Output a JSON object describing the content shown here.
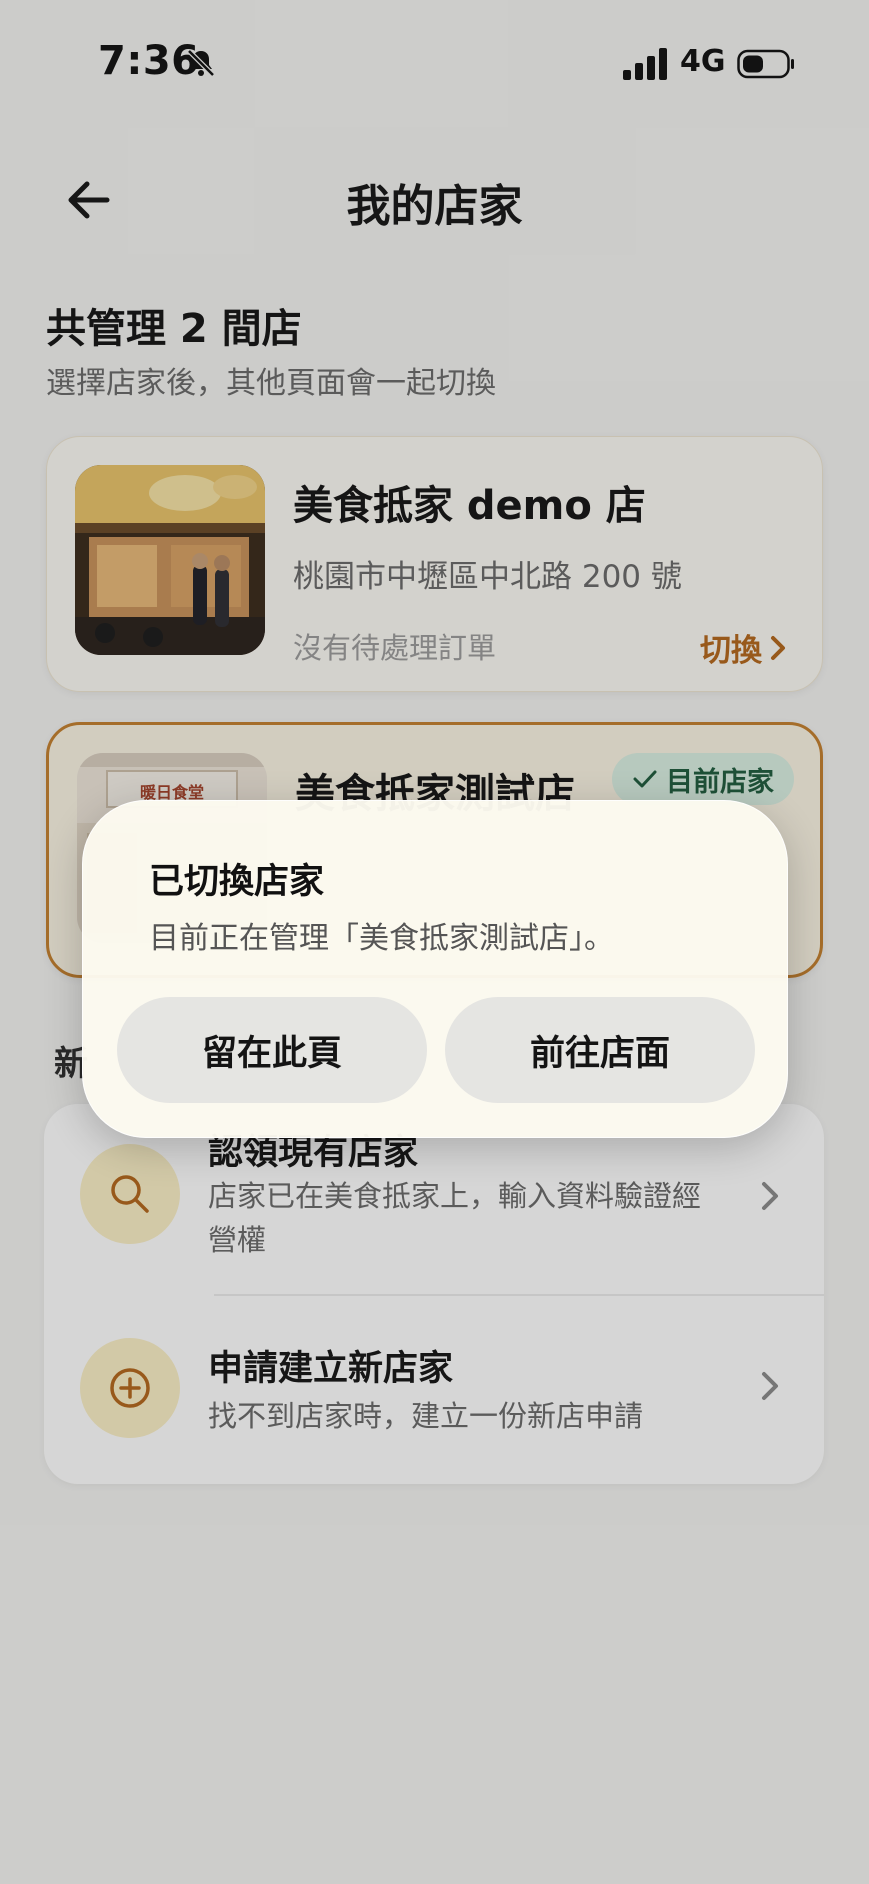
{
  "status_bar": {
    "time": "7:36",
    "network": "4G",
    "icons": [
      "bell-muted-icon",
      "signal-icon",
      "battery-icon"
    ]
  },
  "header": {
    "title": "我的店家",
    "back_icon": "arrow-left-icon"
  },
  "summary": {
    "title": "共管理 2 間店",
    "subtitle": "選擇店家後，其他頁面會一起切換"
  },
  "stores": [
    {
      "name": "美食抵家 demo 店",
      "address": "桃園市中壢區中北路 200 號",
      "status": "沒有待處理訂單",
      "action_label": "切換"
    },
    {
      "name": "美食抵家測試店",
      "badge": "目前店家",
      "sign_text": "暖日食堂"
    }
  ],
  "section": {
    "title": "新"
  },
  "actions": [
    {
      "title": "認領現有店家",
      "desc": "店家已在美食抵家上，輸入資料驗證經營權",
      "icon": "search-icon"
    },
    {
      "title": "申請建立新店家",
      "desc": "找不到店家時，建立一份新店申請",
      "icon": "plus-circle-icon"
    }
  ],
  "dialog": {
    "title": "已切換店家",
    "message": "目前正在管理「美食抵家測試店」。",
    "stay_label": "留在此頁",
    "go_label": "前往店面"
  },
  "colors": {
    "accent": "#b4671c",
    "current_border": "#c47f2e",
    "badge_bg": "#d9efe2",
    "badge_text": "#1f5c3e",
    "icon_bg": "#fbefc6"
  }
}
